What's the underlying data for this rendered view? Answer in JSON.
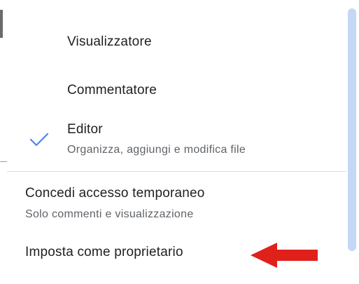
{
  "menu": {
    "roles": [
      {
        "label": "Visualizzatore",
        "selected": false
      },
      {
        "label": "Commentatore",
        "selected": false
      },
      {
        "label": "Editor",
        "description": "Organizza, aggiungi e modifica file",
        "selected": true
      }
    ],
    "actions": [
      {
        "label": "Concedi accesso temporaneo",
        "description": "Solo commenti e visualizzazione"
      },
      {
        "label": "Imposta come proprietario"
      }
    ]
  },
  "icons": {
    "selected_check": "check-icon",
    "annotation_arrow": "arrow-left-icon"
  },
  "colors": {
    "check": "#4a86e8",
    "arrow": "#e0201b",
    "scroll_thumb": "#c4d7f5",
    "divider": "#dadce0"
  }
}
